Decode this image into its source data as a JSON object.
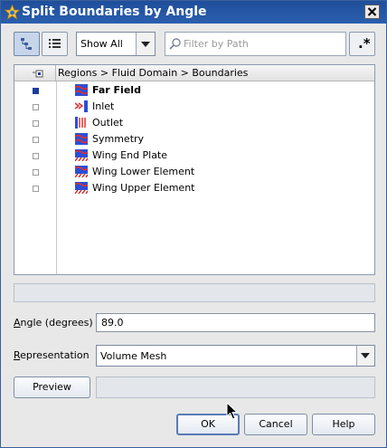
{
  "window": {
    "title": "Split Boundaries by Angle",
    "icons": {
      "app": "star-ccm-app-icon",
      "close": "close-icon"
    }
  },
  "toolbar": {
    "view_tree_icon": "tree-view-icon",
    "view_list_icon": "list-view-icon",
    "show_filter": "Show All",
    "filter_placeholder": "Filter by Path",
    "regex_label": ".*"
  },
  "tree": {
    "header_path": "Regions > Fluid Domain > Boundaries",
    "items": [
      {
        "label": "Far Field",
        "selected": true,
        "bold": true,
        "icon": "freestream-boundary-icon"
      },
      {
        "label": "Inlet",
        "selected": false,
        "bold": false,
        "icon": "velocity-inlet-icon"
      },
      {
        "label": "Outlet",
        "selected": false,
        "bold": false,
        "icon": "pressure-outlet-icon"
      },
      {
        "label": "Symmetry",
        "selected": false,
        "bold": false,
        "icon": "symmetry-plane-icon"
      },
      {
        "label": "Wing End Plate",
        "selected": false,
        "bold": false,
        "icon": "wall-boundary-icon"
      },
      {
        "label": "Wing Lower Element",
        "selected": false,
        "bold": false,
        "icon": "wall-boundary-icon"
      },
      {
        "label": "Wing Upper Element",
        "selected": false,
        "bold": false,
        "icon": "wall-boundary-icon"
      }
    ]
  },
  "angle": {
    "label_prefix": "",
    "label_mnemonic": "A",
    "label_rest": "ngle (degrees)",
    "value": "89.0"
  },
  "representation": {
    "label_mnemonic": "R",
    "label_rest": "epresentation",
    "value": "Volume Mesh"
  },
  "buttons": {
    "preview": "Preview",
    "ok": "OK",
    "cancel": "Cancel",
    "help": "Help"
  },
  "colors": {
    "title_bar": "#1f4e9a",
    "selected_checkbox": "#1b3d9b"
  }
}
